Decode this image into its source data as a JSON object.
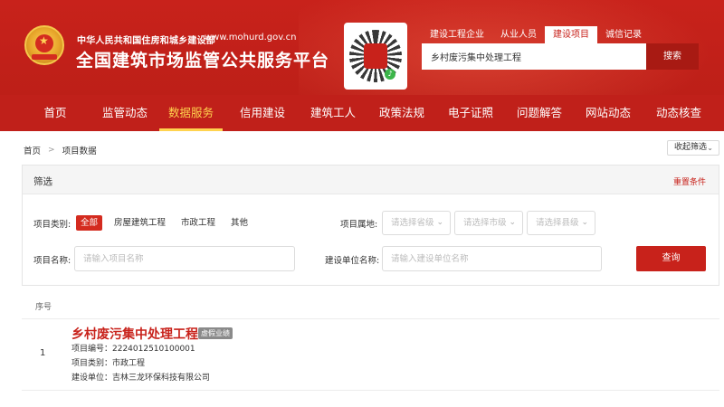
{
  "header": {
    "ministry": "中华人民共和国住房和城乡建设部",
    "url": "www.mohurd.gov.cn",
    "title": "全国建筑市场监管公共服务平台"
  },
  "search": {
    "tabs": [
      {
        "label": "建设工程企业"
      },
      {
        "label": "从业人员"
      },
      {
        "label": "建设项目",
        "active": true
      },
      {
        "label": "诚信记录"
      }
    ],
    "value": "乡村废污集中处理工程",
    "button": "搜索"
  },
  "nav": {
    "items": [
      {
        "label": "首页"
      },
      {
        "label": "监管动态"
      },
      {
        "label": "数据服务",
        "active": true
      },
      {
        "label": "信用建设"
      },
      {
        "label": "建筑工人"
      },
      {
        "label": "政策法规"
      },
      {
        "label": "电子证照"
      },
      {
        "label": "问题解答"
      },
      {
        "label": "网站动态"
      },
      {
        "label": "动态核查"
      }
    ]
  },
  "breadcrumb": {
    "home": "首页",
    "current": "项目数据"
  },
  "collapse_label": "收起筛选",
  "filter": {
    "title": "筛选",
    "reset": "重置条件",
    "category_label": "项目类别:",
    "categories": [
      "全部",
      "房屋建筑工程",
      "市政工程",
      "其他"
    ],
    "location_label": "项目属地:",
    "province_placeholder": "请选择省级",
    "city_placeholder": "请选择市级",
    "county_placeholder": "请选择县级",
    "name_label": "项目名称:",
    "name_placeholder": "请输入项目名称",
    "unit_label": "建设单位名称:",
    "unit_placeholder": "请输入建设单位名称",
    "query": "查询"
  },
  "results": {
    "col_index": "序号",
    "rows": [
      {
        "index": "1",
        "title": "乡村废污集中处理工程",
        "tag": "虚假业绩",
        "code": "项目编号：2224012510100001",
        "category": "项目类别：市政工程",
        "unit": "建设单位：吉林三龙环保科技有限公司"
      }
    ]
  },
  "colors": {
    "brand_red": "#c8221b",
    "nav_active": "#ffd34f"
  }
}
